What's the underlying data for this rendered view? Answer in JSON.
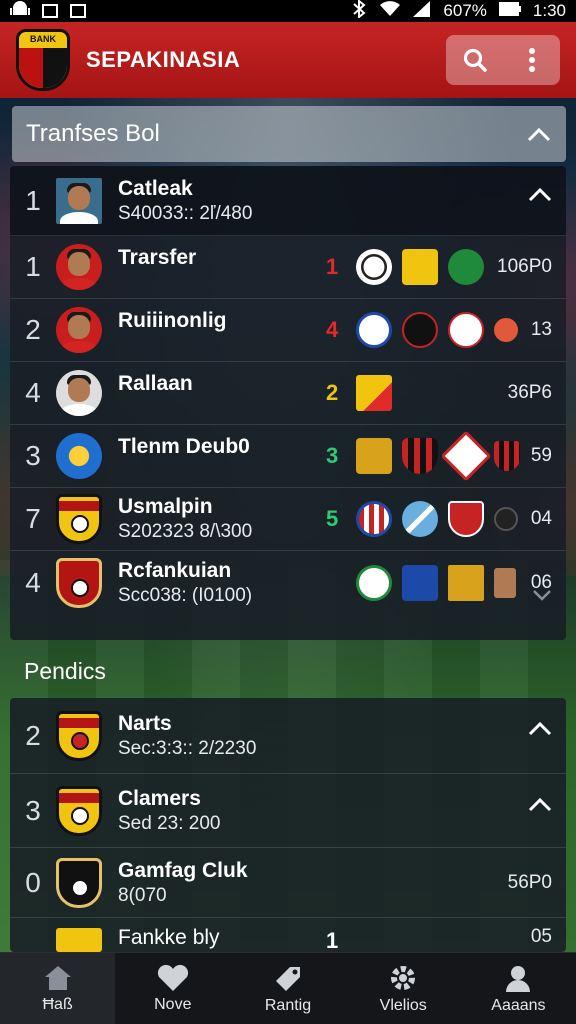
{
  "status_bar": {
    "battery_percent": "607%",
    "time": "1:30"
  },
  "header": {
    "title": "SEPAKINASIA",
    "logo_text": "BANK"
  },
  "section1": {
    "title": "Tranfses Bol"
  },
  "top_row": {
    "rank": "1",
    "name": "Catleak",
    "sub": "S40033:: 2ľ/480"
  },
  "rows": [
    {
      "rank": "1",
      "name": "Trarsfer",
      "form": "1",
      "form_color": "#e12a2a",
      "score": "106P0"
    },
    {
      "rank": "2",
      "name": "Ruiiinonlig",
      "form": "4",
      "form_color": "#e12a2a",
      "score": "13"
    },
    {
      "rank": "4",
      "name": "Rallaan",
      "form": "2",
      "form_color": "#f1c40f",
      "score": "36P6"
    },
    {
      "rank": "3",
      "name": "Tlenm Deub0",
      "form": "3",
      "form_color": "#2ecc71",
      "score": "59"
    },
    {
      "rank": "7",
      "name": "Usmalpin",
      "sub": "S202323 8/\\300",
      "form": "5",
      "form_color": "#2ecc71",
      "score": "04"
    },
    {
      "rank": "4",
      "name": "Rcfankuian",
      "sub": "Scc038: (I0100)",
      "score": "06"
    }
  ],
  "section2": {
    "title": "Pendics"
  },
  "rows2": [
    {
      "rank": "2",
      "name": "Narts",
      "sub": "Sec:3:3:: 2/2230"
    },
    {
      "rank": "3",
      "name": "Clamers",
      "sub": "Sed 23: 200"
    },
    {
      "rank": "0",
      "name": "Gamfag Cluk",
      "sub": "8(070",
      "score": "56P0"
    },
    {
      "rank": "",
      "name": "Fankke bly",
      "form": "1",
      "score": "05"
    }
  ],
  "nav": [
    {
      "label": "Ħaß",
      "icon": "home-icon"
    },
    {
      "label": "Nove",
      "icon": "heart-icon"
    },
    {
      "label": "Rantig",
      "icon": "tag-icon"
    },
    {
      "label": "Vlelios",
      "icon": "gear-icon"
    },
    {
      "label": "Aaaans",
      "icon": "user-icon"
    }
  ]
}
